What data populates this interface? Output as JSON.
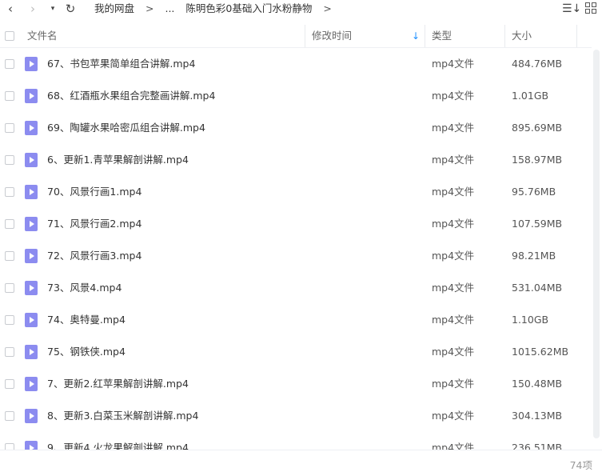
{
  "nav": {
    "back": "‹",
    "forward": "›",
    "dropdown": "▾",
    "refresh": "↻"
  },
  "breadcrumb": {
    "root": "我的网盘",
    "sep": ">",
    "ellipsis": "...",
    "current": "陈明色彩0基础入门水粉静物",
    "end": ">"
  },
  "toolbar": {
    "sort_glyph": "☰↓"
  },
  "columns": {
    "name": "文件名",
    "modified": "修改时间",
    "type": "类型",
    "size": "大小",
    "sort_indicator": "↓"
  },
  "files": [
    {
      "name": "67、书包苹果简单组合讲解.mp4",
      "type": "mp4文件",
      "size": "484.76MB"
    },
    {
      "name": "68、红酒瓶水果组合完整画讲解.mp4",
      "type": "mp4文件",
      "size": "1.01GB"
    },
    {
      "name": "69、陶罐水果哈密瓜组合讲解.mp4",
      "type": "mp4文件",
      "size": "895.69MB"
    },
    {
      "name": "6、更新1.青苹果解剖讲解.mp4",
      "type": "mp4文件",
      "size": "158.97MB"
    },
    {
      "name": "70、风景行画1.mp4",
      "type": "mp4文件",
      "size": "95.76MB"
    },
    {
      "name": "71、风景行画2.mp4",
      "type": "mp4文件",
      "size": "107.59MB"
    },
    {
      "name": "72、风景行画3.mp4",
      "type": "mp4文件",
      "size": "98.21MB"
    },
    {
      "name": "73、风景4.mp4",
      "type": "mp4文件",
      "size": "531.04MB"
    },
    {
      "name": "74、奥特曼.mp4",
      "type": "mp4文件",
      "size": "1.10GB"
    },
    {
      "name": "75、钢铁侠.mp4",
      "type": "mp4文件",
      "size": "1015.62MB"
    },
    {
      "name": "7、更新2.红苹果解剖讲解.mp4",
      "type": "mp4文件",
      "size": "150.48MB"
    },
    {
      "name": "8、更新3.白菜玉米解剖讲解.mp4",
      "type": "mp4文件",
      "size": "304.13MB"
    },
    {
      "name": "9、更新4.火龙果解剖讲解.mp4",
      "type": "mp4文件",
      "size": "236.51MB"
    }
  ],
  "footer": {
    "count": "74项"
  },
  "colors": {
    "accent": "#1e90ff",
    "file_icon": "#8c8cf0"
  }
}
